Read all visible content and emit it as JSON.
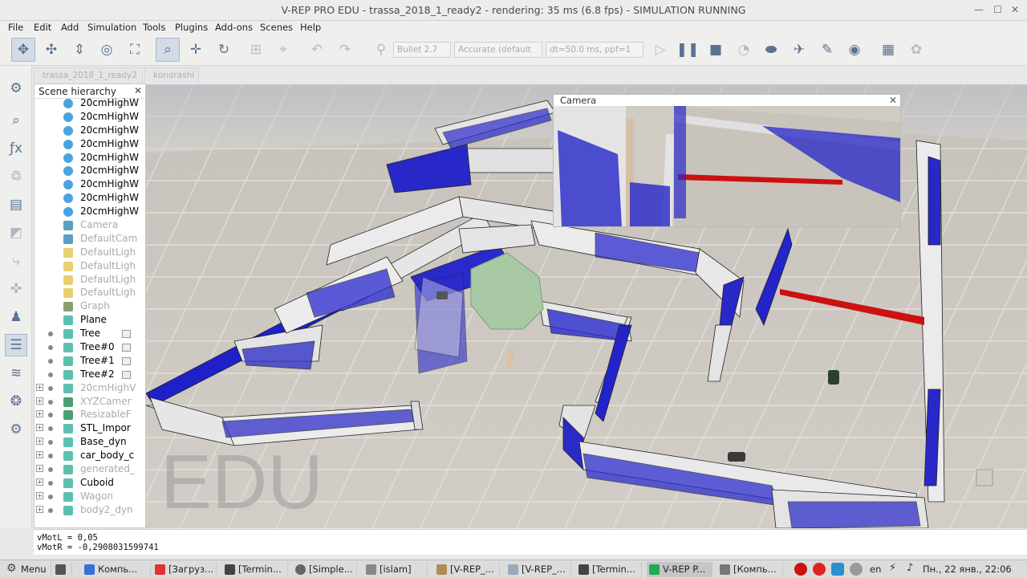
{
  "window": {
    "title": "V-REP PRO EDU - trassa_2018_1_ready2 - rendering: 35 ms (6.8 fps) - SIMULATION RUNNING"
  },
  "menu": [
    "File",
    "Edit",
    "Add",
    "Simulation",
    "Tools",
    "Plugins",
    "Add-ons",
    "Scenes",
    "Help"
  ],
  "toolbar": {
    "engine": "Bullet 2.7",
    "accuracy": "Accurate (default",
    "timestep": "dt=50.0 ms, ppf=1"
  },
  "scene_tabs": [
    "trassa_2018_1_ready2",
    "kondrashi"
  ],
  "hierarchy": {
    "title": "Scene hierarchy",
    "items": [
      {
        "label": "20cmHighW",
        "dim": false,
        "icon": "wall-icon"
      },
      {
        "label": "20cmHighW",
        "dim": false,
        "icon": "wall-icon"
      },
      {
        "label": "20cmHighW",
        "dim": false,
        "icon": "wall-icon"
      },
      {
        "label": "20cmHighW",
        "dim": false,
        "icon": "wall-icon"
      },
      {
        "label": "20cmHighW",
        "dim": false,
        "icon": "wall-icon"
      },
      {
        "label": "20cmHighW",
        "dim": false,
        "icon": "wall-icon"
      },
      {
        "label": "20cmHighW",
        "dim": false,
        "icon": "wall-icon"
      },
      {
        "label": "20cmHighW",
        "dim": false,
        "icon": "wall-icon"
      },
      {
        "label": "20cmHighW",
        "dim": false,
        "icon": "wall-icon"
      },
      {
        "label": "Camera",
        "dim": true,
        "icon": "camera-icon"
      },
      {
        "label": "DefaultCam",
        "dim": true,
        "icon": "camera-icon"
      },
      {
        "label": "DefaultLigh",
        "dim": true,
        "icon": "light-icon"
      },
      {
        "label": "DefaultLigh",
        "dim": true,
        "icon": "light-icon"
      },
      {
        "label": "DefaultLigh",
        "dim": true,
        "icon": "light-icon"
      },
      {
        "label": "DefaultLigh",
        "dim": true,
        "icon": "light-icon"
      },
      {
        "label": "Graph",
        "dim": true,
        "icon": "graph-icon"
      },
      {
        "label": "Plane",
        "dim": false,
        "icon": "shape-icon"
      },
      {
        "label": "Tree",
        "dim": false,
        "icon": "shape-icon"
      },
      {
        "label": "Tree#0",
        "dim": false,
        "icon": "shape-icon"
      },
      {
        "label": "Tree#1",
        "dim": false,
        "icon": "shape-icon"
      },
      {
        "label": "Tree#2",
        "dim": false,
        "icon": "shape-icon"
      },
      {
        "label": "20cmHighV",
        "dim": true,
        "icon": "shape-icon"
      },
      {
        "label": "XYZCamer",
        "dim": true,
        "icon": "model-icon"
      },
      {
        "label": "ResizableF",
        "dim": true,
        "icon": "model-icon"
      },
      {
        "label": "STL_Impor",
        "dim": false,
        "icon": "shape-icon"
      },
      {
        "label": "Base_dyn",
        "dim": false,
        "icon": "shape-icon"
      },
      {
        "label": "car_body_c",
        "dim": false,
        "icon": "shape-icon"
      },
      {
        "label": "generated_",
        "dim": true,
        "icon": "shape-icon"
      },
      {
        "label": "Cuboid",
        "dim": false,
        "icon": "shape-icon"
      },
      {
        "label": "Wagon",
        "dim": true,
        "icon": "shape-icon"
      },
      {
        "label": "body2_dyn",
        "dim": true,
        "icon": "shape-icon"
      }
    ]
  },
  "camera_view": {
    "title": "Camera"
  },
  "viewport": {
    "watermark": "EDU"
  },
  "status": {
    "line1": "vMotL = 0,05",
    "line2": "vMotR = -0,2908031599741"
  },
  "taskbar": {
    "menu": "Menu",
    "tasks": [
      "Компь...",
      "[Загруз...",
      "[Termin...",
      "[Simple...",
      "[islam]",
      "[V-REP_...",
      "[V-REP_...",
      "[Termin...",
      "V-REP P...",
      "[Компь..."
    ],
    "lang": "en",
    "clock": "Пн., 22 янв., 22:06"
  },
  "colors": {
    "wall_blue": "#1a1acc",
    "wall_top": "#e6e6e6",
    "floor": "#c9c4bc",
    "accent_red": "#cc1111"
  }
}
